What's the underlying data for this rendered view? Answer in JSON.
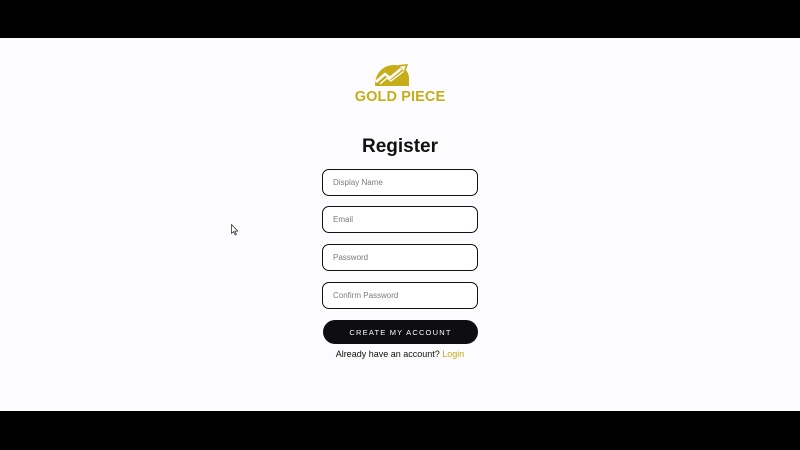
{
  "brand": {
    "name": "GOLD PIECE",
    "logo_icon": "chart-arrow-up-icon",
    "color": "#c7ad1a"
  },
  "form": {
    "title": "Register",
    "display_name_placeholder": "Display Name",
    "email_placeholder": "Email",
    "password_placeholder": "Password",
    "confirm_password_placeholder": "Confirm Password",
    "display_name_value": "",
    "email_value": "",
    "password_value": "",
    "confirm_password_value": "",
    "submit_label": "CREATE MY ACCOUNT"
  },
  "footer": {
    "prompt": "Already have an account?",
    "login_label": "Login"
  },
  "colors": {
    "background": "#fcfbfd",
    "letterbox": "#000000",
    "button": "#0e0e10",
    "accent": "#c7ad1a"
  }
}
